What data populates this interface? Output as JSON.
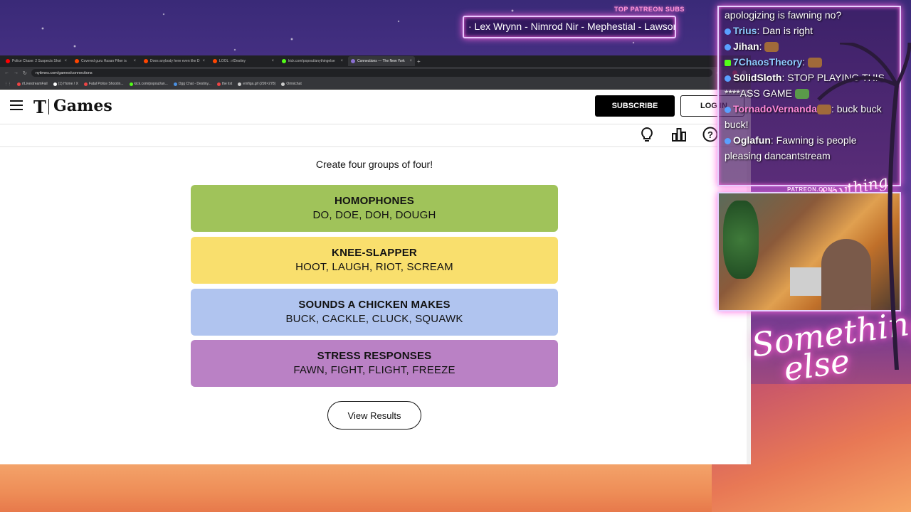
{
  "overlay": {
    "patreon_label": "TOP PATREON SUBS",
    "patreon_names": "· Lex Wrynn - Nimrod Nir - Mephestial - Lawsor",
    "patreon_url": "PATREON.COM/",
    "signature": "Anything else",
    "logo_line1": "Something",
    "logo_line2": "else"
  },
  "browser": {
    "tabs": [
      {
        "label": "Police Chase: 2 Suspects Shot",
        "color": "#ff0000"
      },
      {
        "label": "Covered guru Hasan Piker is",
        "color": "#ff4500"
      },
      {
        "label": "Does anybody here even like D",
        "color": "#ff4500"
      },
      {
        "label": "LOOL : r/Destiny",
        "color": "#ff4500"
      },
      {
        "label": "kick.com/popout/anythingelse",
        "color": "#53fc18"
      },
      {
        "label": "Connections — The New York",
        "color": "#8a6fd1",
        "active": true
      }
    ],
    "url": "nytimes.com/games/connections",
    "bookmarks": [
      "r/LivestreamFail",
      "(1) Home / X",
      "Fatal Police Shootin...",
      "kick.com/popout/an...",
      "Dgg Chat - Destiny...",
      "the list",
      "emfiga.gif (299×278)",
      "Omnichat"
    ]
  },
  "nyt": {
    "logo_t": "T",
    "logo_games": "Games",
    "subscribe": "SUBSCRIBE",
    "login": "LOG IN"
  },
  "game": {
    "instructions": "Create four groups of four!",
    "groups": [
      {
        "title": "HOMOPHONES",
        "members": "DO, DOE, DOH, DOUGH",
        "color": "#a0c35a"
      },
      {
        "title": "KNEE-SLAPPER",
        "members": "HOOT, LAUGH, RIOT, SCREAM",
        "color": "#f9df6d"
      },
      {
        "title": "SOUNDS A CHICKEN MAKES",
        "members": "BUCK, CACKLE, CLUCK, SQUAWK",
        "color": "#b0c4ef"
      },
      {
        "title": "STRESS RESPONSES",
        "members": "FAWN, FIGHT, FLIGHT, FREEZE",
        "color": "#ba81c5"
      }
    ],
    "view_results": "View Results"
  },
  "chat": {
    "messages": [
      {
        "user": "",
        "text": "apologizing is fawning no?",
        "color": "#ffffff"
      },
      {
        "user": "Trius",
        "text": ": Dan is right",
        "color": "#8ecbff"
      },
      {
        "user": "Jihan",
        "text": ":",
        "color": "#ffffff",
        "emote": true
      },
      {
        "user": "7ChaosTheory",
        "text": ":",
        "color": "#8ecbff",
        "emote": true
      },
      {
        "user": "S0lidSloth",
        "text": ": STOP PLAYING THIS ****ASS GAME",
        "color": "#ffffff",
        "emote": true
      },
      {
        "user": "TornadoVernanda",
        "text": ": buck buck buck!",
        "color": "#ff8ad8",
        "emote": true
      },
      {
        "user": "Oglafun",
        "text": ": Fawning is people pleasing dancantstream",
        "color": "#ffffff"
      }
    ]
  }
}
